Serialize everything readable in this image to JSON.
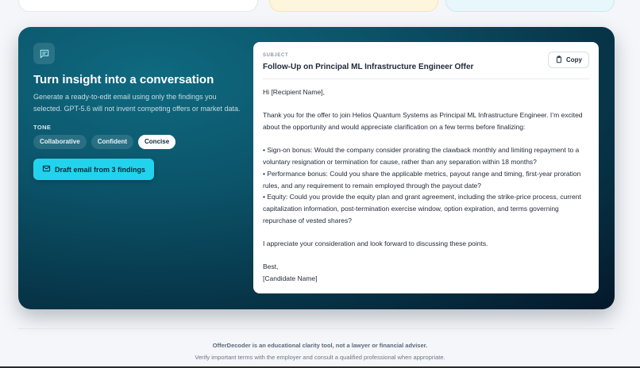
{
  "panel": {
    "title": "Turn insight into a conversation",
    "description": "Generate a ready-to-edit email using only the findings you selected. GPT-5.6 will not invent competing offers or market data.",
    "tone_label": "TONE",
    "tones": [
      {
        "label": "Collaborative",
        "active": false
      },
      {
        "label": "Confident",
        "active": false
      },
      {
        "label": "Concise",
        "active": true
      }
    ],
    "draft_button": "Draft email from 3 findings"
  },
  "email": {
    "subject_label": "SUBJECT",
    "subject": "Follow-Up on Principal ML Infrastructure Engineer Offer",
    "copy_label": "Copy",
    "greeting": "Hi [Recipient Name],",
    "intro": "Thank you for the offer to join Helios Quantum Systems as Principal ML Infrastructure Engineer. I’m excited about the opportunity and would appreciate clarification on a few terms before finalizing:",
    "bullets": [
      "• Sign-on bonus: Would the company consider prorating the clawback monthly and limiting repayment to a voluntary resignation or termination for cause, rather than any separation within 18 months?",
      "• Performance bonus: Could you share the applicable metrics, payout range and timing, first-year proration rules, and any requirement to remain employed through the payout date?",
      "• Equity: Could you provide the equity plan and grant agreement, including the strike-price process, current capitalization information, post-termination exercise window, option expiration, and terms governing repurchase of vested shares?"
    ],
    "closing": "I appreciate your consideration and look forward to discussing these points.",
    "signoff": "Best,",
    "signature": "[Candidate Name]"
  },
  "footer": {
    "line1": "OfferDecoder is an educational clarity tool, not a lawyer or financial adviser.",
    "line2": "Verify important terms with the employer and consult a qualified professional when appropriate."
  },
  "colors": {
    "accent": "#22d3ee",
    "panel_dark": "#073447"
  },
  "icons": {
    "panel_badge": "chat-icon",
    "draft_button": "mail-icon",
    "copy_button": "clipboard-icon"
  }
}
